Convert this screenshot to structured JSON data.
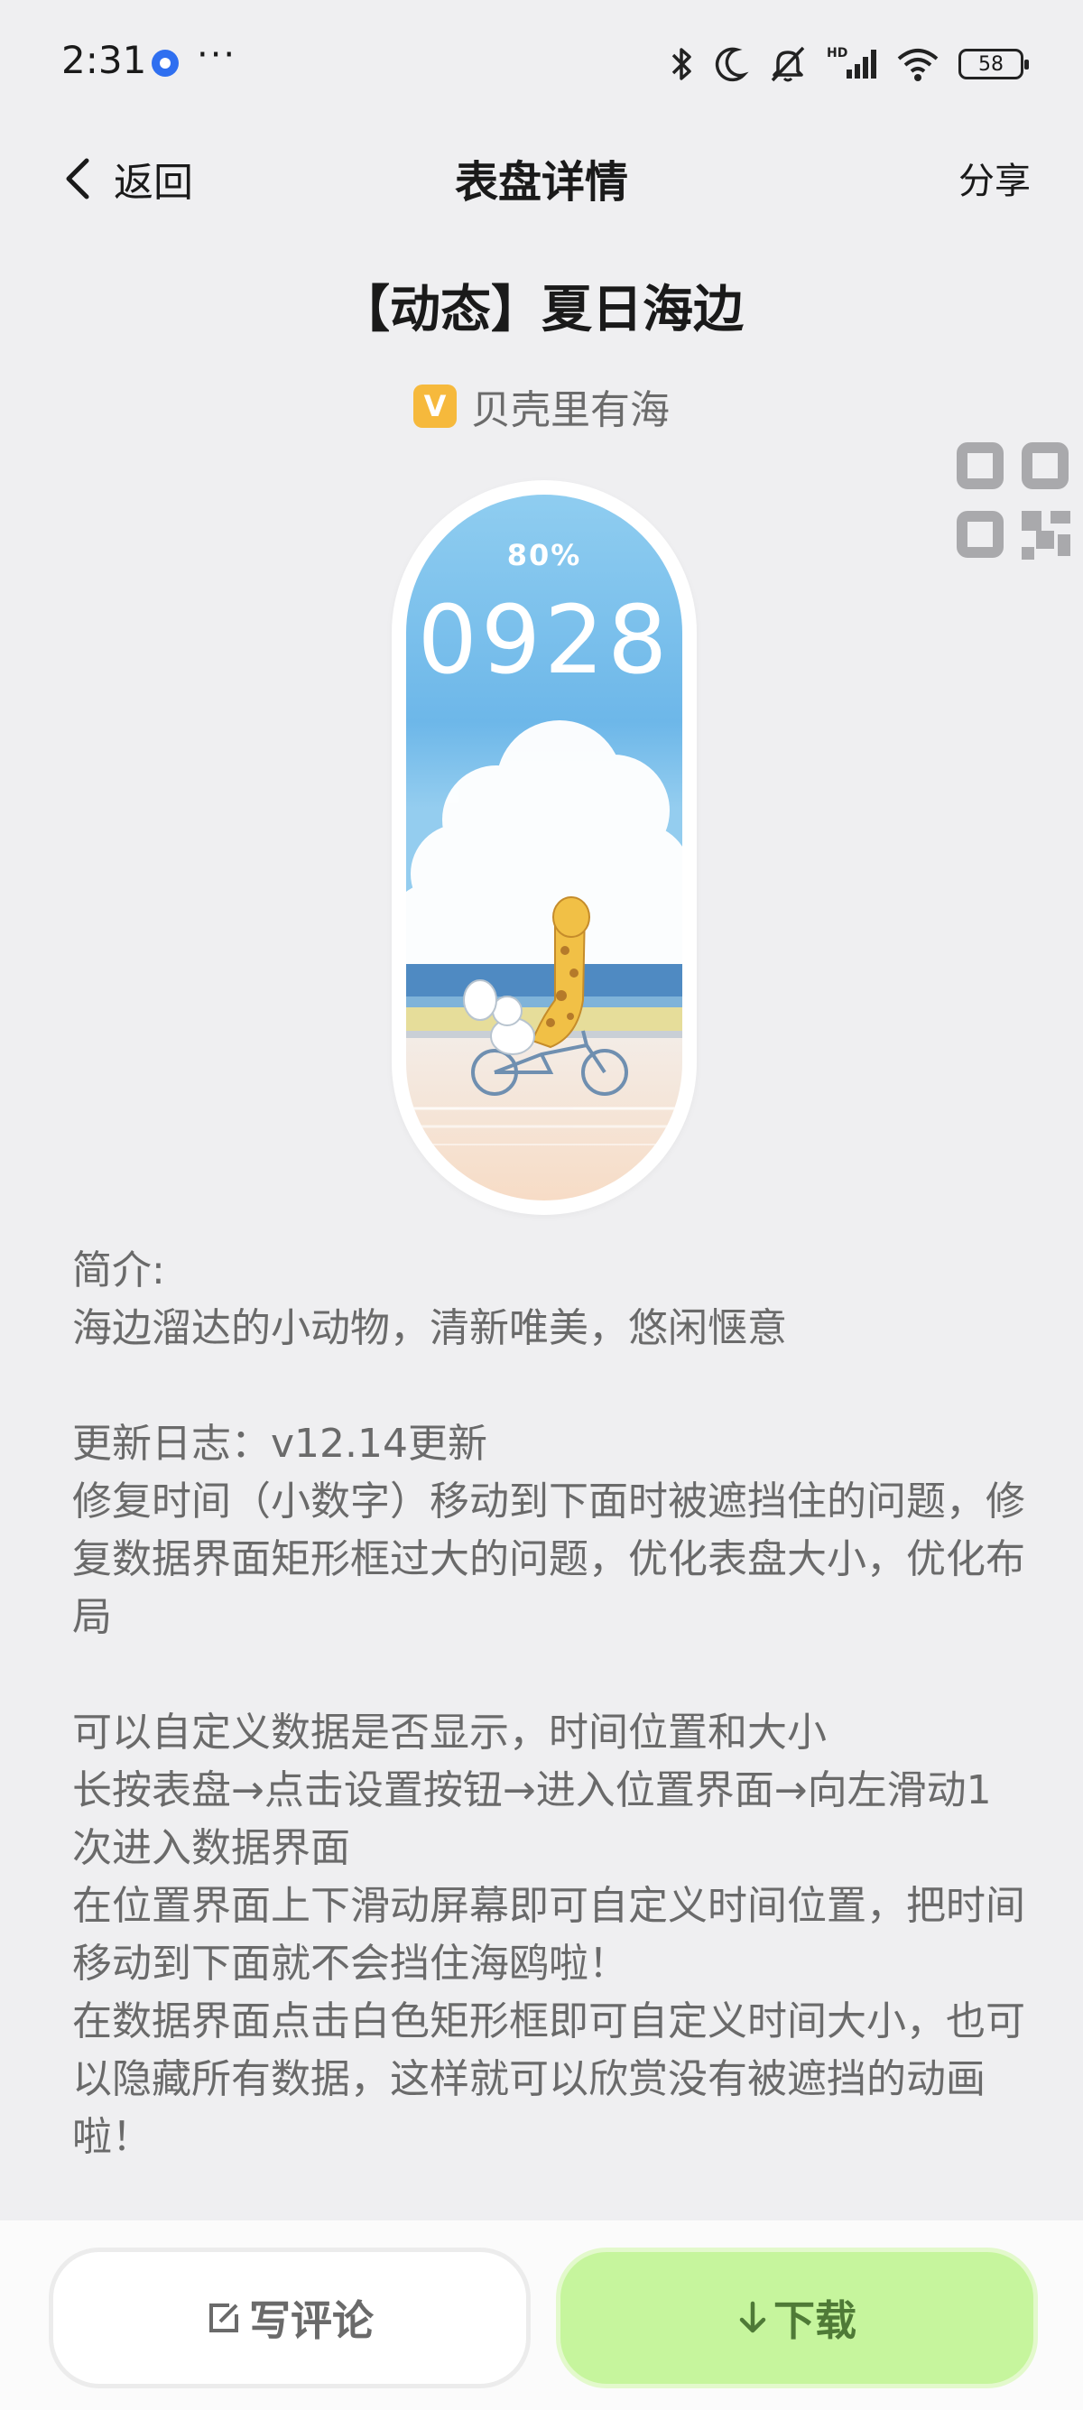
{
  "status_bar": {
    "time": "2:31",
    "more": "···",
    "battery": "58",
    "icons": [
      "bluetooth-icon",
      "moon-icon",
      "mute-icon",
      "hd-signal-icon",
      "wifi-icon",
      "battery-icon"
    ]
  },
  "nav": {
    "back_label": "返回",
    "title": "表盘详情",
    "share_label": "分享"
  },
  "watchface": {
    "title": "【动态】夏日海边",
    "author_badge": "V",
    "author": "贝壳里有海",
    "preview_battery": "80%",
    "preview_time": "0928"
  },
  "description": {
    "intro_label": "简介:",
    "intro": "海边溜达的小动物，清新唯美，悠闲惬意",
    "changelog_title": "更新日志：v12.14更新",
    "changelog_body": "修复时间（小数字）移动到下面时被遮挡住的问题，修复数据界面矩形框过大的问题，优化表盘大小，优化布局",
    "custom_line1": "可以自定义数据是否显示，时间位置和大小",
    "custom_line2": "长按表盘→点击设置按钮→进入位置界面→向左滑动1次进入数据界面",
    "custom_line3": "在位置界面上下滑动屏幕即可自定义时间位置，把时间移动到下面就不会挡住海鸥啦！",
    "custom_line4": "在数据界面点击白色矩形框即可自定义时间大小，也可以隐藏所有数据，这样就可以欣赏没有被遮挡的动画啦！"
  },
  "actions": {
    "comment_label": "写评论",
    "download_label": "下载"
  },
  "colors": {
    "background": "#efeff1",
    "download_bg": "#c6f59d",
    "download_text": "#4f7a37",
    "author_badge": "#f6b93c"
  }
}
